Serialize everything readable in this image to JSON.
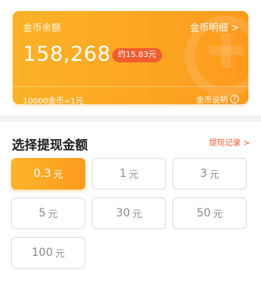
{
  "balance_card": {
    "label": "金币余额",
    "detail_link": "金币明细 >",
    "amount": "158,268",
    "approx_value": "约15.83元",
    "rate": "10000金币=1元",
    "explain_link": "金币说明",
    "help_icon": "?",
    "colors": {
      "gradient_start": "#fbb227",
      "gradient_end": "#fd9a1f",
      "badge": "#f15d2e"
    }
  },
  "withdraw": {
    "title": "选择提现金额",
    "record_link": "提现记录 >",
    "unit": "元",
    "selected_index": 0,
    "options": [
      {
        "value": "0.3"
      },
      {
        "value": "1"
      },
      {
        "value": "3"
      },
      {
        "value": "5"
      },
      {
        "value": "30"
      },
      {
        "value": "50"
      },
      {
        "value": "100"
      }
    ],
    "colors": {
      "accent": "#fd9b1f",
      "record_link": "#f05b2a"
    }
  }
}
